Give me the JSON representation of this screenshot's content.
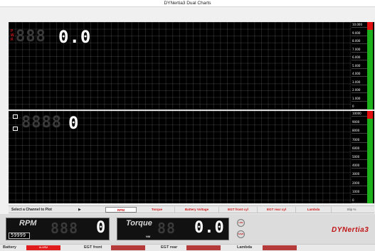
{
  "window": {
    "title": "DYNertia3 Dual Charts"
  },
  "top_chart": {
    "channel_letters": [
      "P",
      "W",
      "R"
    ],
    "readout_ghost": "888",
    "readout_value": "0.0",
    "scale_ticks": [
      "10.000",
      "9.000",
      "8.000",
      "7.000",
      "6.000",
      "5.000",
      "4.000",
      "3.000",
      "2.000",
      "1.000",
      "0"
    ],
    "meter_colors": {
      "high": "#e01010",
      "normal": "#1db21d"
    }
  },
  "bottom_chart": {
    "readout_ghost": "8888",
    "readout_value": "0",
    "scale_ticks": [
      "10000",
      "9000",
      "8000",
      "7000",
      "6000",
      "5000",
      "4000",
      "3000",
      "2000",
      "1000",
      "0"
    ]
  },
  "channel_selector": {
    "label": "Select a Channel to Plot",
    "arrow": "▶",
    "buttons": [
      "RPM",
      "Torque",
      "Battery Voltage",
      "EGT front cyl",
      "EGT rear cyl",
      "Lambda",
      "Slip %"
    ]
  },
  "gauges": {
    "rpm": {
      "title": "RPM",
      "mini_value": "59999",
      "ghost": "888",
      "value": "0"
    },
    "torque": {
      "title": "Torque",
      "unit": "NM",
      "ghost": "88",
      "value": "0.0"
    },
    "buttons": [
      "LOG",
      "SAVE"
    ]
  },
  "logo": "DYNertia3",
  "status": {
    "items": [
      {
        "label": "Battery",
        "value": "ALARM"
      },
      {
        "label": "EGT front",
        "value": ""
      },
      {
        "label": "EGT rear",
        "value": ""
      },
      {
        "label": "Lambda",
        "value": ""
      }
    ]
  }
}
